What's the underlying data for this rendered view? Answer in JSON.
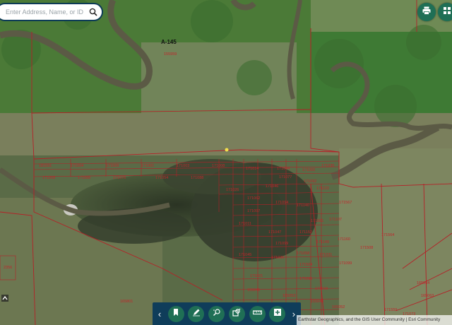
{
  "search": {
    "placeholder": "Enter Address, Name, or ID"
  },
  "top_buttons": [
    {
      "name": "print-button",
      "icon": "printer-icon"
    },
    {
      "name": "basemap-button",
      "icon": "grid-icon"
    }
  ],
  "map": {
    "survey_label": "A-145",
    "parcel_labels": [
      "155959",
      "181591",
      "171004",
      "171009",
      "171001",
      "171003",
      "171008",
      "171014",
      "171044",
      "171055",
      "171030",
      "171077",
      "171092",
      "171122",
      "171046",
      "171026",
      "171062",
      "171094",
      "171140",
      "171097",
      "171567",
      "171564",
      "171508",
      "171081",
      "171107",
      "171011",
      "171047",
      "171152",
      "171149",
      "171099",
      "171160",
      "171045",
      "171030",
      "171504",
      "171031",
      "171099",
      "171021",
      "171091",
      "165054",
      "165063",
      "155045",
      "155053",
      "155045",
      "165052",
      "171559",
      "171073",
      "171016",
      "165801",
      "2356",
      "171068",
      "171066",
      "171076",
      "171054",
      "171088",
      "171058"
    ],
    "colors": {
      "parcel_line": "#b52027",
      "parcel_label": "#c0262b",
      "survey_label": "#111111"
    }
  },
  "toolbar": {
    "prev": "‹",
    "next": "›",
    "buttons": [
      {
        "name": "bookmark-button",
        "icon": "bookmark-icon"
      },
      {
        "name": "draw-button",
        "icon": "pencil-icon"
      },
      {
        "name": "identify-button",
        "icon": "identify-icon"
      },
      {
        "name": "select-button",
        "icon": "select-icon"
      },
      {
        "name": "measure-button",
        "icon": "ruler-icon"
      },
      {
        "name": "add-data-button",
        "icon": "plus-square-icon"
      }
    ],
    "colors": {
      "bar": "#0f3d5a",
      "button": "#1f6f55"
    }
  },
  "attribution": {
    "text": "Earthstar Geographics, and the GIS User Community | Esri Community"
  }
}
